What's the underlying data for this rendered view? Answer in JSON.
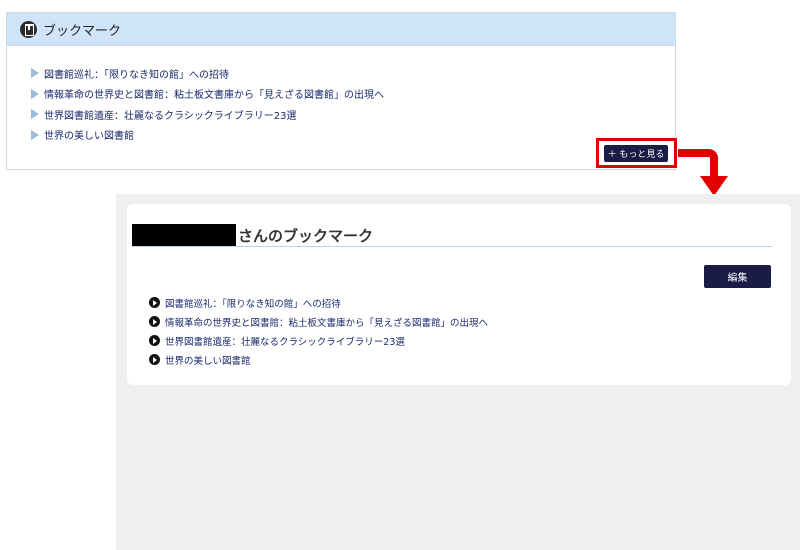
{
  "bookmark_widget": {
    "title": "ブックマーク",
    "items": [
      "図書館巡礼：「限りなき知の館」への招待",
      "情報革命の世界史と図書館：粘土板文書庫から「見えざる図書館」の出現へ",
      "世界図書館遺産：壮麗なるクラシックライブラリー23選",
      "世界の美しい図書館"
    ],
    "more_button": "＋ もっと見る"
  },
  "bookmark_page": {
    "title": "さんのブックマーク",
    "edit_button": "編集",
    "items": [
      "図書館巡礼：「限りなき知の館」への招待",
      "情報革命の世界史と図書館：粘土板文書庫から「見えざる図書館」の出現へ",
      "世界図書館遺産：壮麗なるクラシックライブラリー23選",
      "世界の美しい図書館"
    ]
  },
  "colors": {
    "header_bg": "#cfe4f8",
    "button_bg": "#1a1b47",
    "highlight": "#e00000",
    "link": "#1a2a6c"
  }
}
